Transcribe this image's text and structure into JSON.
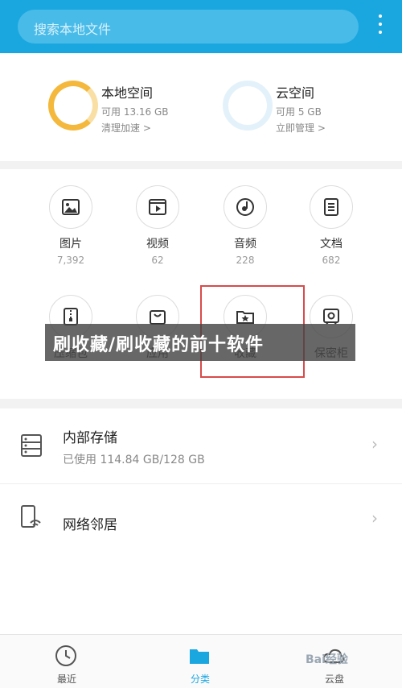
{
  "search": {
    "placeholder": "搜索本地文件"
  },
  "storage": {
    "local": {
      "title": "本地空间",
      "available": "可用 13.16 GB",
      "action": "清理加速 >"
    },
    "cloud": {
      "title": "云空间",
      "available": "可用 5 GB",
      "action": "立即管理 >"
    }
  },
  "categories": [
    {
      "label": "图片",
      "count": "7,392"
    },
    {
      "label": "视频",
      "count": "62"
    },
    {
      "label": "音频",
      "count": "228"
    },
    {
      "label": "文档",
      "count": "682"
    },
    {
      "label": "压缩包"
    },
    {
      "label": "应用"
    },
    {
      "label": "收藏"
    },
    {
      "label": "保密柜"
    }
  ],
  "banner": {
    "text": "刷收藏/刷收藏的前十软件"
  },
  "internal_storage": {
    "title": "内部存储",
    "usage": "已使用 114.84 GB/128 GB"
  },
  "network": {
    "title": "网络邻居"
  },
  "tabs": [
    {
      "label": "最近"
    },
    {
      "label": "分类",
      "active": true
    },
    {
      "label": "云盘"
    }
  ],
  "watermark": {
    "text": "Bai经验"
  },
  "colors": {
    "accent": "#1aa7e0",
    "local_ring": "#f4b83d",
    "highlight": "#d84b4b"
  }
}
